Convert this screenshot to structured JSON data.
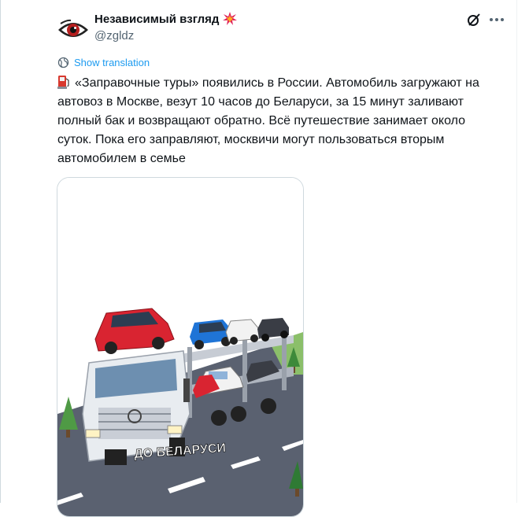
{
  "author": {
    "display_name": "Независимый взгляд",
    "name_emoji_icon": "collision-icon",
    "handle": "@zgldz",
    "avatar_icon": "eye-logo-icon"
  },
  "header_actions": {
    "grok_icon": "grok-slash-icon",
    "more_icon": "more-dots-icon"
  },
  "translate": {
    "icon": "globe-icon",
    "label": "Show translation"
  },
  "tweet": {
    "leading_emoji_icon": "fuel-pump-icon",
    "text": "«Заправочные туры» появились в России. Автомобиль загружают на автовоз в Москве, везут 10 часов до Беларуси, за 15 минут заливают полный бак и возвращают обратно. Всё путешествие занимает около суток. Пока его заправляют, москвичи могут пользоваться вторым автомобилем  в семье"
  },
  "media": {
    "caption": "ДО БЕЛАРУСИ",
    "colors": {
      "sky": "#ffffff",
      "road": "#5a6170",
      "grass": "#8bbf6a",
      "truck": "#e8ecf0",
      "car_red": "#d92431",
      "car_blue": "#1f74d6",
      "car_white": "#f2f2f2",
      "car_dark": "#3a3d45"
    }
  }
}
